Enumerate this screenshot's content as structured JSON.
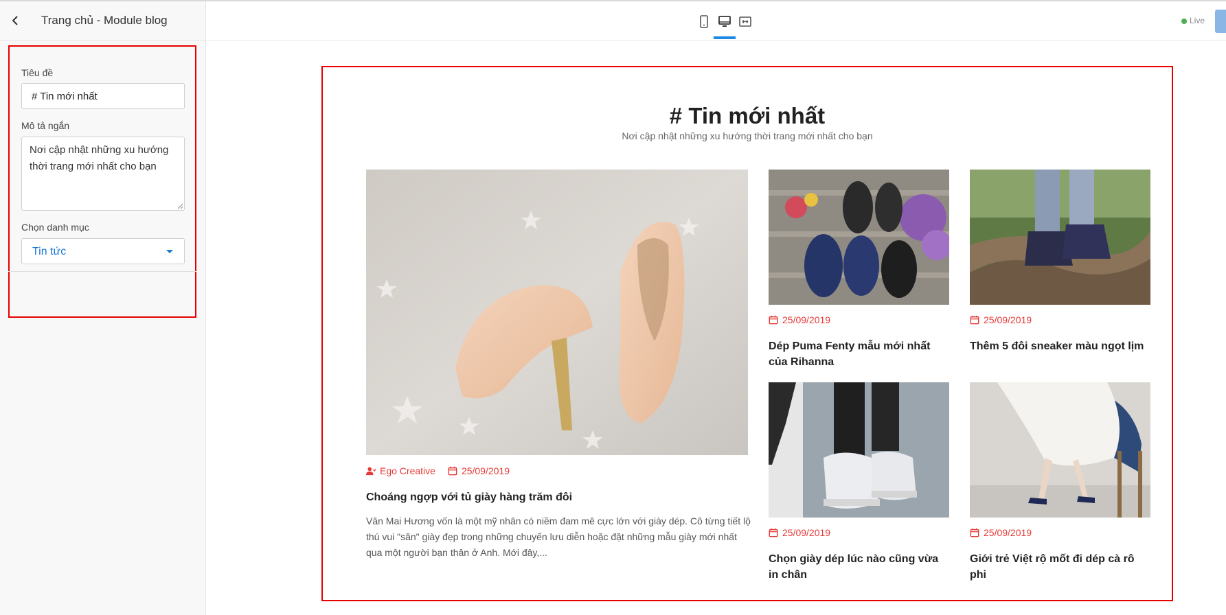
{
  "sidebar": {
    "title": "Trang chủ - Module blog",
    "fields": {
      "title_label": "Tiêu đề",
      "title_value": "# Tin mới nhất",
      "desc_label": "Mô tả ngắn",
      "desc_value": "Nơi cập nhật những xu hướng thời trang mới nhất cho bạn",
      "category_label": "Chọn danh mục",
      "category_value": "Tin tức"
    }
  },
  "topbar": {
    "live_label": "Live"
  },
  "colors": {
    "accent": "#1e88e5",
    "highlight_border": "#e60000",
    "meta_red": "#e53935",
    "live_green": "#4caf50"
  },
  "blog": {
    "heading": "# Tin mới nhất",
    "subheading": "Nơi cập nhật những xu hướng thời trang mới nhất cho bạn",
    "featured": {
      "author": "Ego Creative",
      "date": "25/09/2019",
      "title": "Choáng ngợp với tủ giày hàng trăm đôi",
      "excerpt": "Văn Mai Hương vốn là một mỹ nhân có niềm đam mê cực lớn với giày dép. Cô từng tiết lộ thú vui \"săn\" giày đẹp trong những chuyến lưu diễn hoặc đặt những mẫu giày mới nhất qua một người bạn thân ở Anh. Mới đây,..."
    },
    "posts": [
      {
        "date": "25/09/2019",
        "title": "Dép Puma Fenty mẫu mới nhất của Rihanna"
      },
      {
        "date": "25/09/2019",
        "title": "Thêm 5 đôi sneaker màu ngọt lịm"
      },
      {
        "date": "25/09/2019",
        "title": "Chọn giày dép lúc nào cũng vừa in chân"
      },
      {
        "date": "25/09/2019",
        "title": "Giới trẻ Việt rộ mốt đi dép cà rô phi"
      }
    ]
  }
}
